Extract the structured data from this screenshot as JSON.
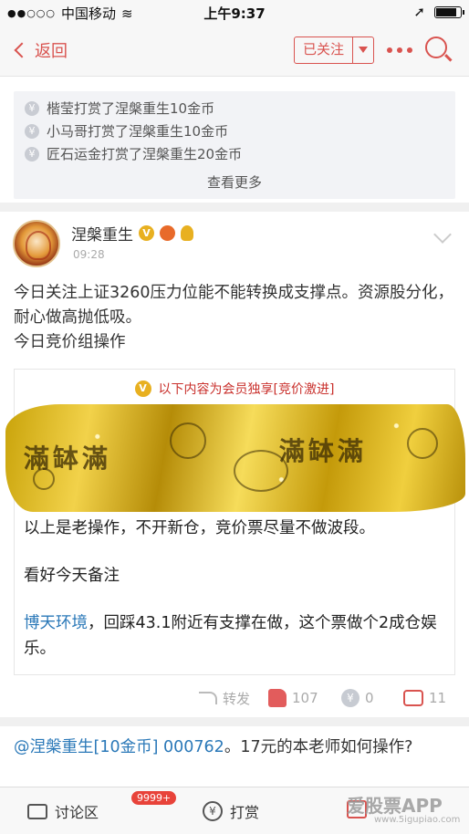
{
  "statusbar": {
    "carrier": "中国移动",
    "time": "上午9:37"
  },
  "nav": {
    "back_label": "返回",
    "follow_label": "已关注"
  },
  "rewards": {
    "items": [
      "楷莹打赏了涅槃重生10金币",
      "小马哥打赏了涅槃重生10金币",
      "匠石运金打赏了涅槃重生20金币"
    ],
    "see_more": "查看更多"
  },
  "post": {
    "author": "涅槃重生",
    "time": "09:28",
    "body_line1": "今日关注上证3260压力位能不能转换成支撑点。资源股分化，耐心做高抛低吸。",
    "body_line2": "今日竞价组操作",
    "vip_notice": "以下内容为会员独享[竞价激进]",
    "vip_line1": "以上是老操作，不开新仓，竞价票尽量不做波段。",
    "vip_line2": "看好今天备注",
    "vip_stock": "博天环境",
    "vip_line3": "，回踩43.1附近有支撑在做，这个票做个2成仓娱乐。",
    "share_label": "转发",
    "like_count": "107",
    "coin_count": "0",
    "comment_count": "11"
  },
  "comment": {
    "mention": "@涅槃重生[10金币]",
    "stock_code": "000762",
    "text": "。17元的本老师如何操作?"
  },
  "tabbar": {
    "discuss_label": "讨论区",
    "discuss_count": "9999+",
    "reward_label": "打赏",
    "watermark": "爱股票APP",
    "watermark_url": "www.5igupiao.com"
  }
}
